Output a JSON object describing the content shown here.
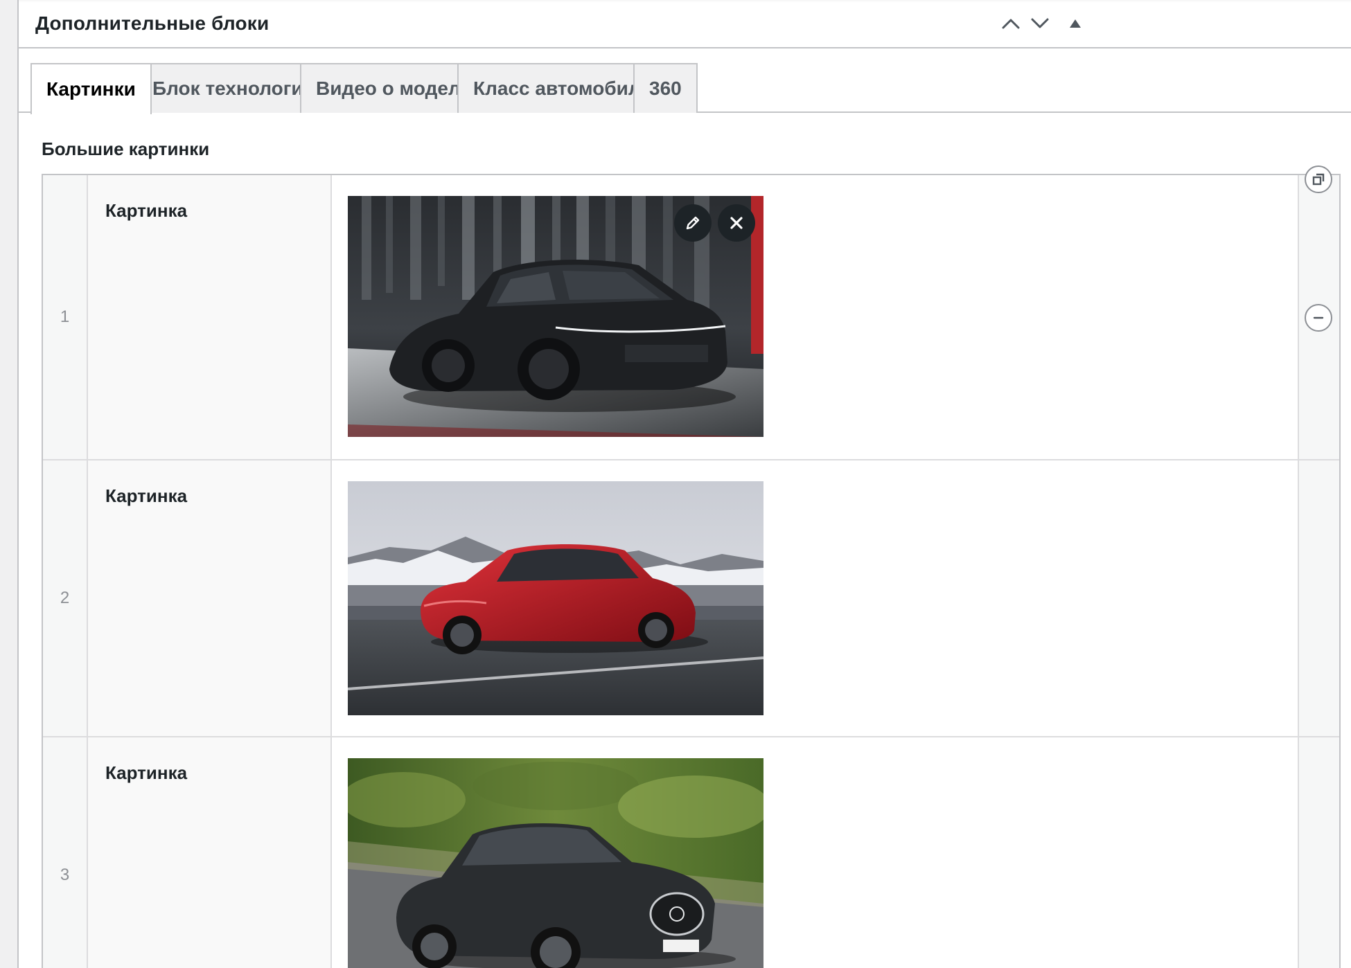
{
  "postbox": {
    "title": "Дополнительные блоки"
  },
  "tabs": [
    {
      "label": "Картинки",
      "active": true
    },
    {
      "label": "Блок технологии",
      "active": false
    },
    {
      "label": "Видео о модели",
      "active": false
    },
    {
      "label": "Класс автомобиля",
      "active": false
    },
    {
      "label": "360",
      "active": false
    }
  ],
  "field": {
    "label": "Большие картинки"
  },
  "rows": [
    {
      "order": "1",
      "label": "Картинка"
    },
    {
      "order": "2",
      "label": "Картинка"
    },
    {
      "order": "3",
      "label": "Картинка"
    }
  ],
  "icons": {
    "move_up": "chevron-up-icon",
    "move_down": "chevron-down-icon",
    "toggle": "triangle-up-icon",
    "edit": "pencil-icon",
    "remove": "close-icon",
    "collapse_all": "duplicate-icon",
    "remove_row": "minus-circle-icon"
  },
  "colors": {
    "border": "#c3c4c7",
    "text": "#1d2327",
    "muted": "#8c8f94",
    "image_button_bg": "#1d2327"
  }
}
